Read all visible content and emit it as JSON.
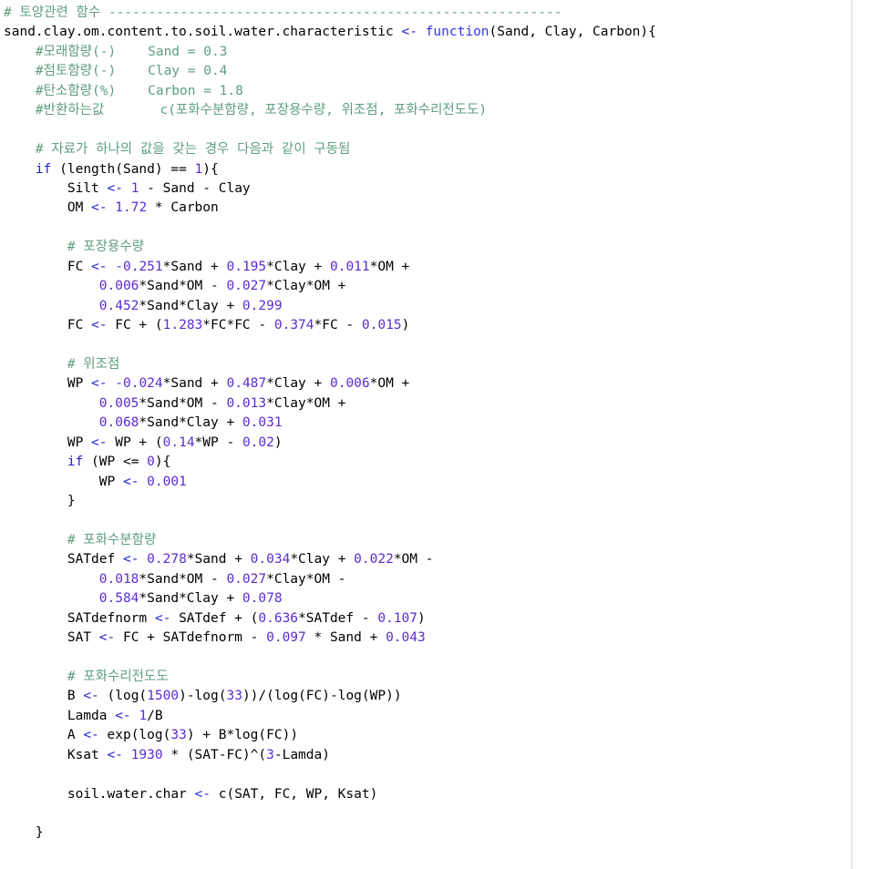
{
  "editor": {
    "language": "R",
    "background": "#ffffff",
    "margin_guide_color": "#d8d8d8",
    "colors": {
      "comment": "#5f9e7e",
      "keyword": "#2020d0",
      "number": "#5b2bd0",
      "plain": "#000000",
      "function": "#3333ee"
    }
  },
  "lines": [
    {
      "id": "l1",
      "indent": 0,
      "tokens": [
        {
          "t": "cm",
          "v": "# 토양관련 함수 ---------------------------------------------------------"
        }
      ]
    },
    {
      "id": "l2",
      "indent": 0,
      "tokens": [
        {
          "t": "pl",
          "v": "sand.clay.om.content.to.soil.water.characteristic "
        },
        {
          "t": "kw",
          "v": "<-"
        },
        {
          "t": "pl",
          "v": " "
        },
        {
          "t": "fn",
          "v": "function"
        },
        {
          "t": "pl",
          "v": "(Sand, Clay, Carbon){"
        }
      ]
    },
    {
      "id": "l3",
      "indent": 1,
      "tokens": [
        {
          "t": "cm",
          "v": "#모래함량(-)    Sand = 0.3"
        }
      ]
    },
    {
      "id": "l4",
      "indent": 1,
      "tokens": [
        {
          "t": "cm",
          "v": "#점토함량(-)    Clay = 0.4"
        }
      ]
    },
    {
      "id": "l5",
      "indent": 1,
      "tokens": [
        {
          "t": "cm",
          "v": "#탄소함량(%)    Carbon = 1.8"
        }
      ]
    },
    {
      "id": "l6",
      "indent": 1,
      "tokens": [
        {
          "t": "cm",
          "v": "#반환하는값       c(포화수분함량, 포장용수량, 위조점, 포화수리전도도)"
        }
      ]
    },
    {
      "id": "l7",
      "indent": 0,
      "tokens": []
    },
    {
      "id": "l8",
      "indent": 1,
      "tokens": [
        {
          "t": "cm",
          "v": "# 자료가 하나의 값을 갖는 경우 다음과 같이 구동됨"
        }
      ]
    },
    {
      "id": "l9",
      "indent": 1,
      "tokens": [
        {
          "t": "kw",
          "v": "if"
        },
        {
          "t": "pl",
          "v": " ("
        },
        {
          "t": "pl",
          "v": "length(Sand) == "
        },
        {
          "t": "num",
          "v": "1"
        },
        {
          "t": "pl",
          "v": "){"
        }
      ]
    },
    {
      "id": "l10",
      "indent": 2,
      "tokens": [
        {
          "t": "pl",
          "v": "Silt "
        },
        {
          "t": "kw",
          "v": "<-"
        },
        {
          "t": "pl",
          "v": " "
        },
        {
          "t": "num",
          "v": "1"
        },
        {
          "t": "pl",
          "v": " - Sand - Clay"
        }
      ]
    },
    {
      "id": "l11",
      "indent": 2,
      "tokens": [
        {
          "t": "pl",
          "v": "OM "
        },
        {
          "t": "kw",
          "v": "<-"
        },
        {
          "t": "pl",
          "v": " "
        },
        {
          "t": "num",
          "v": "1.72"
        },
        {
          "t": "pl",
          "v": " * Carbon"
        }
      ]
    },
    {
      "id": "l12",
      "indent": 0,
      "tokens": []
    },
    {
      "id": "l13",
      "indent": 2,
      "tokens": [
        {
          "t": "cm",
          "v": "# 포장용수량"
        }
      ]
    },
    {
      "id": "l14",
      "indent": 2,
      "tokens": [
        {
          "t": "pl",
          "v": "FC "
        },
        {
          "t": "kw",
          "v": "<-"
        },
        {
          "t": "pl",
          "v": " "
        },
        {
          "t": "num",
          "v": "-0.251"
        },
        {
          "t": "pl",
          "v": "*Sand + "
        },
        {
          "t": "num",
          "v": "0.195"
        },
        {
          "t": "pl",
          "v": "*Clay + "
        },
        {
          "t": "num",
          "v": "0.011"
        },
        {
          "t": "pl",
          "v": "*OM +"
        }
      ]
    },
    {
      "id": "l15",
      "indent": 3,
      "tokens": [
        {
          "t": "num",
          "v": "0.006"
        },
        {
          "t": "pl",
          "v": "*Sand*OM - "
        },
        {
          "t": "num",
          "v": "0.027"
        },
        {
          "t": "pl",
          "v": "*Clay*OM +"
        }
      ]
    },
    {
      "id": "l16",
      "indent": 3,
      "tokens": [
        {
          "t": "num",
          "v": "0.452"
        },
        {
          "t": "pl",
          "v": "*Sand*Clay + "
        },
        {
          "t": "num",
          "v": "0.299"
        }
      ]
    },
    {
      "id": "l17",
      "indent": 2,
      "tokens": [
        {
          "t": "pl",
          "v": "FC "
        },
        {
          "t": "kw",
          "v": "<-"
        },
        {
          "t": "pl",
          "v": " FC + ("
        },
        {
          "t": "num",
          "v": "1.283"
        },
        {
          "t": "pl",
          "v": "*FC*FC - "
        },
        {
          "t": "num",
          "v": "0.374"
        },
        {
          "t": "pl",
          "v": "*FC - "
        },
        {
          "t": "num",
          "v": "0.015"
        },
        {
          "t": "pl",
          "v": ")"
        }
      ]
    },
    {
      "id": "l18",
      "indent": 0,
      "tokens": []
    },
    {
      "id": "l19",
      "indent": 2,
      "tokens": [
        {
          "t": "cm",
          "v": "# 위조점"
        }
      ]
    },
    {
      "id": "l20",
      "indent": 2,
      "tokens": [
        {
          "t": "pl",
          "v": "WP "
        },
        {
          "t": "kw",
          "v": "<-"
        },
        {
          "t": "pl",
          "v": " "
        },
        {
          "t": "num",
          "v": "-0.024"
        },
        {
          "t": "pl",
          "v": "*Sand + "
        },
        {
          "t": "num",
          "v": "0.487"
        },
        {
          "t": "pl",
          "v": "*Clay + "
        },
        {
          "t": "num",
          "v": "0.006"
        },
        {
          "t": "pl",
          "v": "*OM +"
        }
      ]
    },
    {
      "id": "l21",
      "indent": 3,
      "tokens": [
        {
          "t": "num",
          "v": "0.005"
        },
        {
          "t": "pl",
          "v": "*Sand*OM - "
        },
        {
          "t": "num",
          "v": "0.013"
        },
        {
          "t": "pl",
          "v": "*Clay*OM +"
        }
      ]
    },
    {
      "id": "l22",
      "indent": 3,
      "tokens": [
        {
          "t": "num",
          "v": "0.068"
        },
        {
          "t": "pl",
          "v": "*Sand*Clay + "
        },
        {
          "t": "num",
          "v": "0.031"
        }
      ]
    },
    {
      "id": "l23",
      "indent": 2,
      "tokens": [
        {
          "t": "pl",
          "v": "WP "
        },
        {
          "t": "kw",
          "v": "<-"
        },
        {
          "t": "pl",
          "v": " WP + ("
        },
        {
          "t": "num",
          "v": "0.14"
        },
        {
          "t": "pl",
          "v": "*WP - "
        },
        {
          "t": "num",
          "v": "0.02"
        },
        {
          "t": "pl",
          "v": ")"
        }
      ]
    },
    {
      "id": "l24",
      "indent": 2,
      "tokens": [
        {
          "t": "kw",
          "v": "if"
        },
        {
          "t": "pl",
          "v": " (WP <= "
        },
        {
          "t": "num",
          "v": "0"
        },
        {
          "t": "pl",
          "v": "){"
        }
      ]
    },
    {
      "id": "l25",
      "indent": 3,
      "tokens": [
        {
          "t": "pl",
          "v": "WP "
        },
        {
          "t": "kw",
          "v": "<-"
        },
        {
          "t": "pl",
          "v": " "
        },
        {
          "t": "num",
          "v": "0.001"
        }
      ]
    },
    {
      "id": "l26",
      "indent": 2,
      "tokens": [
        {
          "t": "pl",
          "v": "}"
        }
      ]
    },
    {
      "id": "l27",
      "indent": 0,
      "tokens": []
    },
    {
      "id": "l28",
      "indent": 2,
      "tokens": [
        {
          "t": "cm",
          "v": "# 포화수분함량"
        }
      ]
    },
    {
      "id": "l29",
      "indent": 2,
      "tokens": [
        {
          "t": "pl",
          "v": "SATdef "
        },
        {
          "t": "kw",
          "v": "<-"
        },
        {
          "t": "pl",
          "v": " "
        },
        {
          "t": "num",
          "v": "0.278"
        },
        {
          "t": "pl",
          "v": "*Sand + "
        },
        {
          "t": "num",
          "v": "0.034"
        },
        {
          "t": "pl",
          "v": "*Clay + "
        },
        {
          "t": "num",
          "v": "0.022"
        },
        {
          "t": "pl",
          "v": "*OM -"
        }
      ]
    },
    {
      "id": "l30",
      "indent": 3,
      "tokens": [
        {
          "t": "num",
          "v": "0.018"
        },
        {
          "t": "pl",
          "v": "*Sand*OM - "
        },
        {
          "t": "num",
          "v": "0.027"
        },
        {
          "t": "pl",
          "v": "*Clay*OM -"
        }
      ]
    },
    {
      "id": "l31",
      "indent": 3,
      "tokens": [
        {
          "t": "num",
          "v": "0.584"
        },
        {
          "t": "pl",
          "v": "*Sand*Clay + "
        },
        {
          "t": "num",
          "v": "0.078"
        }
      ]
    },
    {
      "id": "l32",
      "indent": 2,
      "tokens": [
        {
          "t": "pl",
          "v": "SATdefnorm "
        },
        {
          "t": "kw",
          "v": "<-"
        },
        {
          "t": "pl",
          "v": " SATdef + ("
        },
        {
          "t": "num",
          "v": "0.636"
        },
        {
          "t": "pl",
          "v": "*SATdef - "
        },
        {
          "t": "num",
          "v": "0.107"
        },
        {
          "t": "pl",
          "v": ")"
        }
      ]
    },
    {
      "id": "l33",
      "indent": 2,
      "tokens": [
        {
          "t": "pl",
          "v": "SAT "
        },
        {
          "t": "kw",
          "v": "<-"
        },
        {
          "t": "pl",
          "v": " FC + SATdefnorm - "
        },
        {
          "t": "num",
          "v": "0.097"
        },
        {
          "t": "pl",
          "v": " * Sand + "
        },
        {
          "t": "num",
          "v": "0.043"
        }
      ]
    },
    {
      "id": "l34",
      "indent": 0,
      "tokens": []
    },
    {
      "id": "l35",
      "indent": 2,
      "tokens": [
        {
          "t": "cm",
          "v": "# 포화수리전도도"
        }
      ]
    },
    {
      "id": "l36",
      "indent": 2,
      "tokens": [
        {
          "t": "pl",
          "v": "B "
        },
        {
          "t": "kw",
          "v": "<-"
        },
        {
          "t": "pl",
          "v": " (log("
        },
        {
          "t": "num",
          "v": "1500"
        },
        {
          "t": "pl",
          "v": ")-log("
        },
        {
          "t": "num",
          "v": "33"
        },
        {
          "t": "pl",
          "v": "))/(log(FC)-log(WP))"
        }
      ]
    },
    {
      "id": "l37",
      "indent": 2,
      "tokens": [
        {
          "t": "pl",
          "v": "Lamda "
        },
        {
          "t": "kw",
          "v": "<-"
        },
        {
          "t": "pl",
          "v": " "
        },
        {
          "t": "num",
          "v": "1"
        },
        {
          "t": "pl",
          "v": "/B"
        }
      ]
    },
    {
      "id": "l38",
      "indent": 2,
      "tokens": [
        {
          "t": "pl",
          "v": "A "
        },
        {
          "t": "kw",
          "v": "<-"
        },
        {
          "t": "pl",
          "v": " exp(log("
        },
        {
          "t": "num",
          "v": "33"
        },
        {
          "t": "pl",
          "v": ") + B*log(FC))"
        }
      ]
    },
    {
      "id": "l39",
      "indent": 2,
      "tokens": [
        {
          "t": "pl",
          "v": "Ksat "
        },
        {
          "t": "kw",
          "v": "<-"
        },
        {
          "t": "pl",
          "v": " "
        },
        {
          "t": "num",
          "v": "1930"
        },
        {
          "t": "pl",
          "v": " * (SAT-FC)^("
        },
        {
          "t": "num",
          "v": "3"
        },
        {
          "t": "pl",
          "v": "-Lamda)"
        }
      ]
    },
    {
      "id": "l40",
      "indent": 0,
      "tokens": []
    },
    {
      "id": "l41",
      "indent": 2,
      "tokens": [
        {
          "t": "pl",
          "v": "soil.water.char "
        },
        {
          "t": "kw",
          "v": "<-"
        },
        {
          "t": "pl",
          "v": " c(SAT, FC, WP, Ksat)"
        }
      ]
    },
    {
      "id": "l42",
      "indent": 0,
      "tokens": []
    },
    {
      "id": "l43",
      "indent": 1,
      "tokens": [
        {
          "t": "pl",
          "v": "}"
        }
      ]
    }
  ]
}
